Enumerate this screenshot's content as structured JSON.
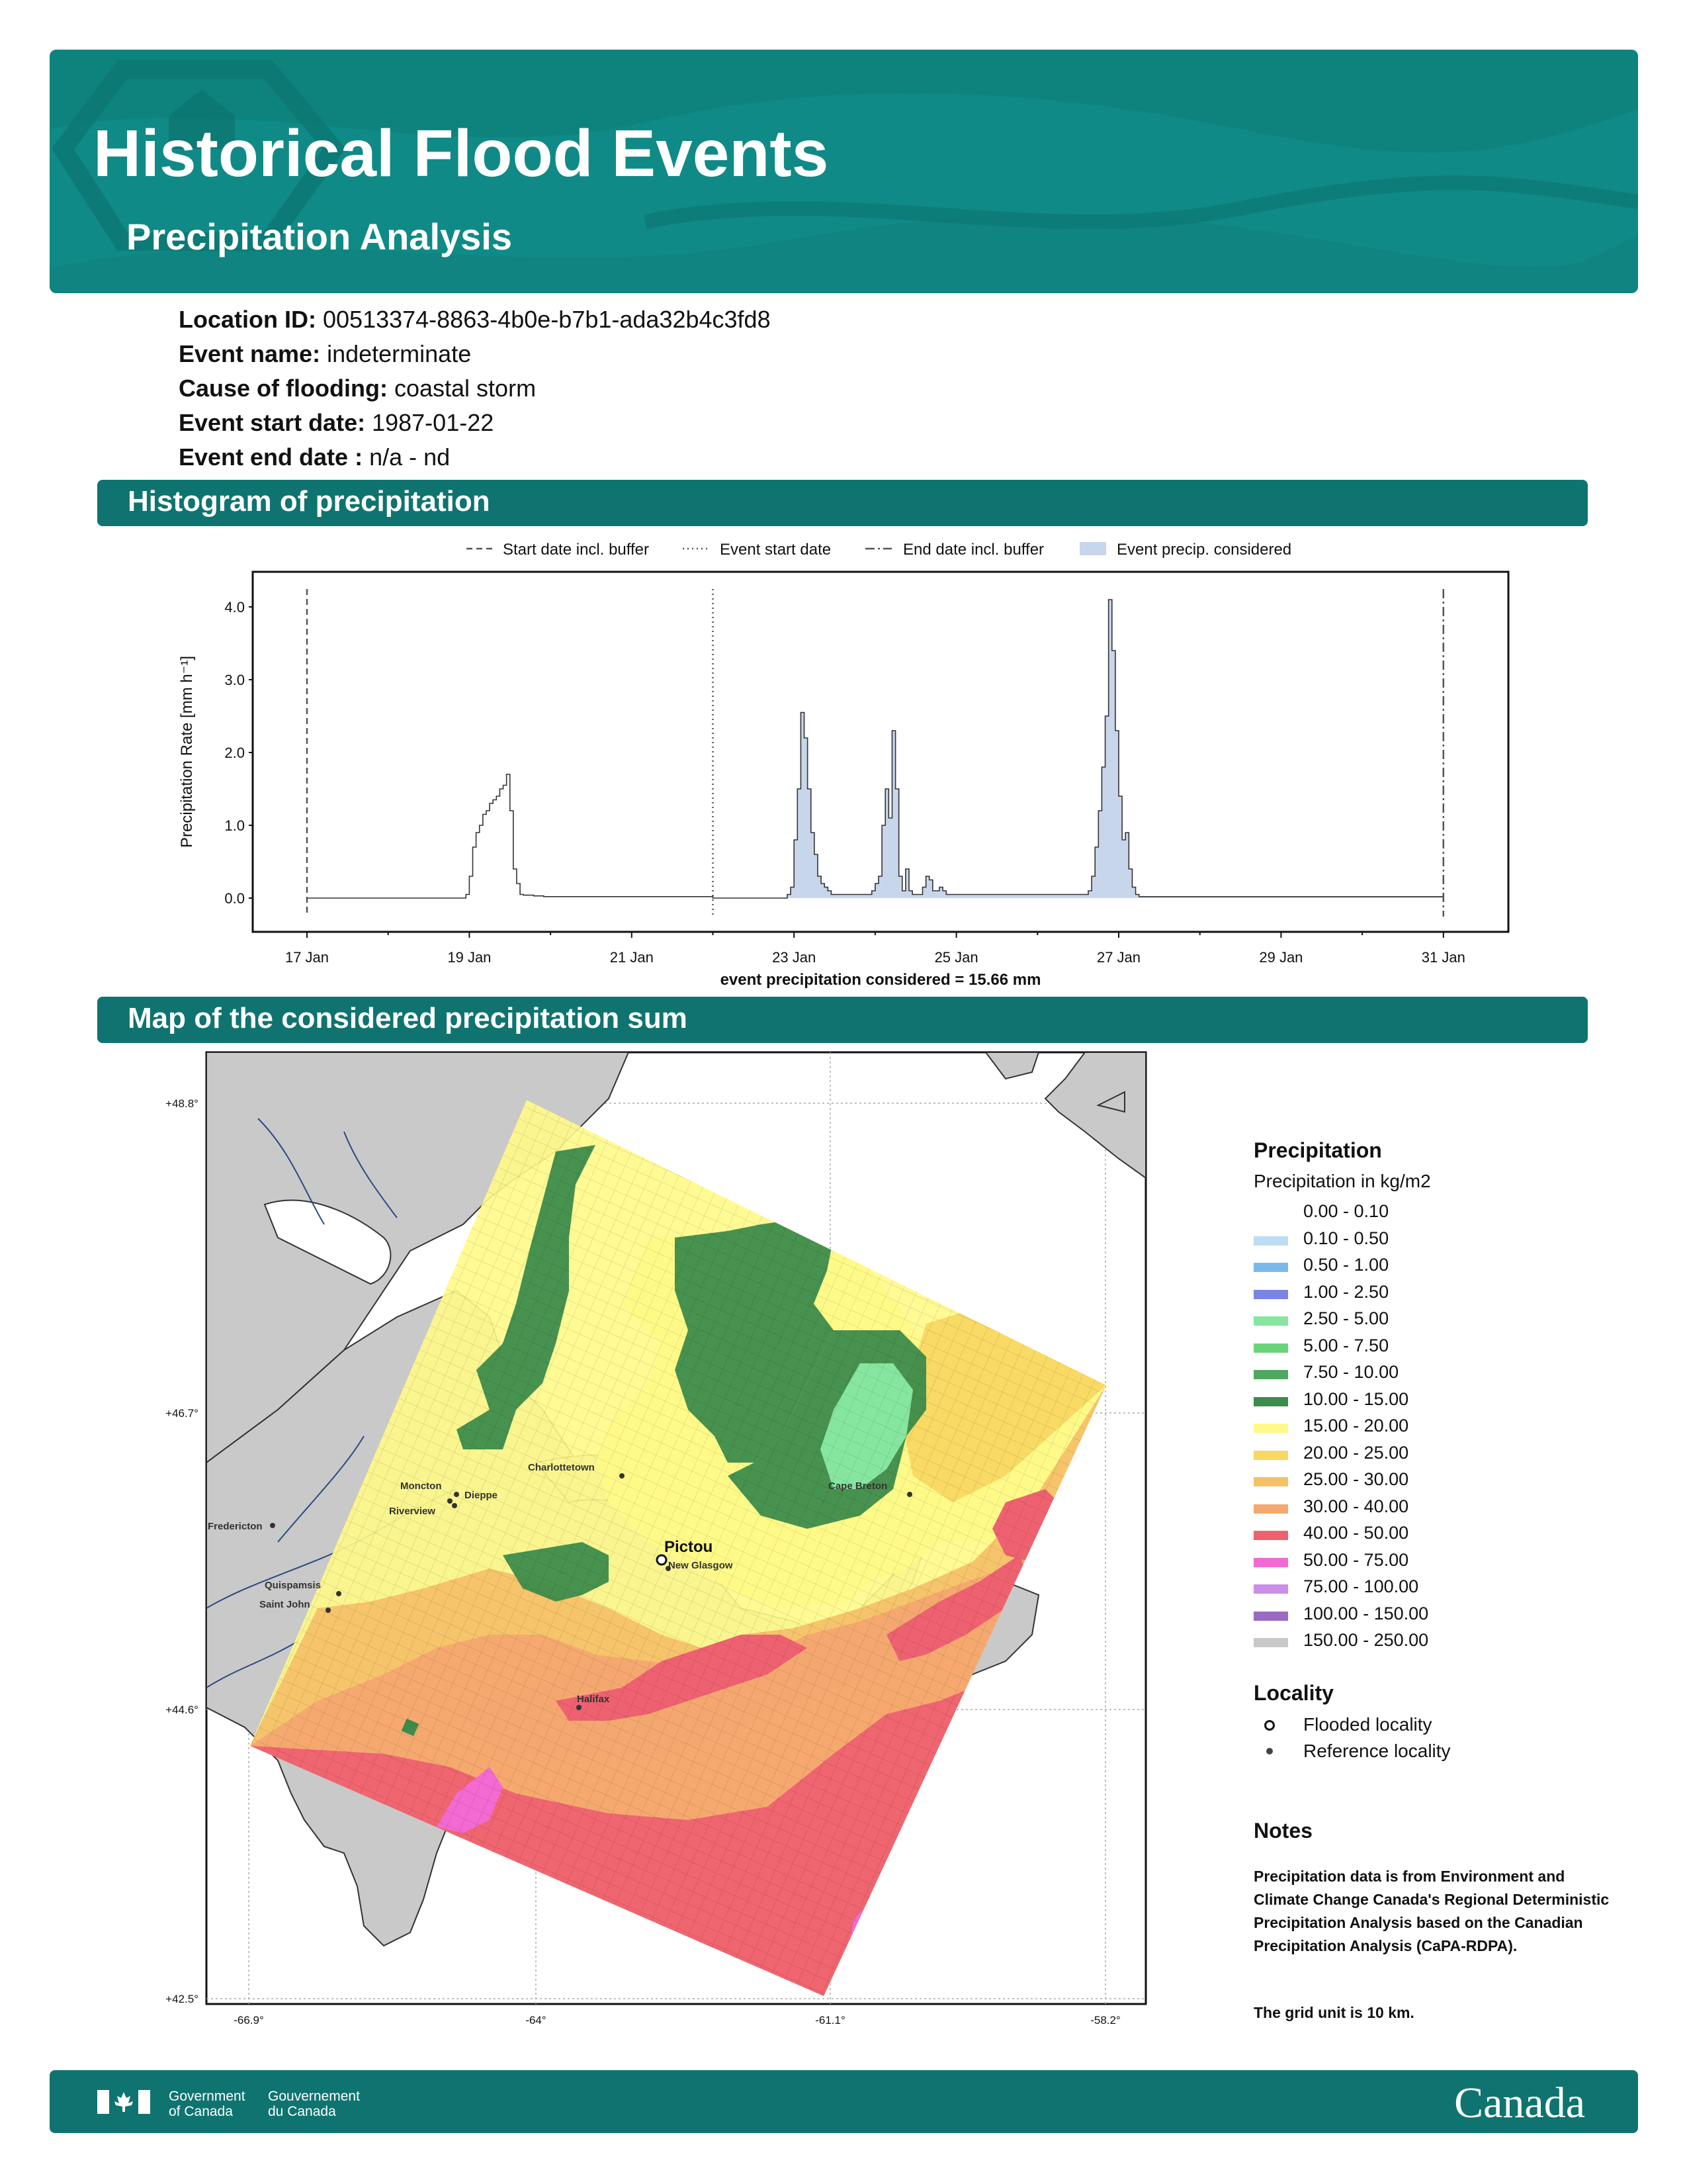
{
  "header": {
    "title": "Historical Flood Events",
    "subtitle": "Precipitation Analysis"
  },
  "event_info": {
    "location_id_label": "Location ID:",
    "location_id": "00513374-8863-4b0e-b7b1-ada32b4c3fd8",
    "event_name_label": "Event name:",
    "event_name": "indeterminate",
    "cause_label": "Cause of flooding:",
    "cause": "coastal storm",
    "start_label": "Event start date:",
    "start": "1987-01-22",
    "end_label": "Event end date :",
    "end": "n/a - nd"
  },
  "sections": {
    "histogram": "Histogram of precipitation",
    "map": "Map of the considered precipitation sum"
  },
  "chart_data": {
    "type": "area",
    "ylabel": "Precipitation Rate [mm h⁻¹]",
    "ylim": [
      0,
      4.4
    ],
    "x_unit": "hours",
    "yticks": [
      "0.0",
      "1.0",
      "2.0",
      "3.0",
      "4.0"
    ],
    "xticks": [
      "17 Jan",
      "19 Jan",
      "21 Jan",
      "23 Jan",
      "25 Jan",
      "27 Jan",
      "29 Jan",
      "31 Jan"
    ],
    "xlabel": "event precipitation considered = 15.66 mm",
    "legend": [
      "Start date incl. buffer",
      "Event start date",
      "End date incl. buffer",
      "Event precip. considered"
    ],
    "vlines": {
      "start_buffer": "1987-01-17",
      "event_start": "1987-01-22",
      "end_buffer": "1987-01-31"
    },
    "fill_range": [
      "1987-01-22",
      "1987-01-31"
    ],
    "series": [
      {
        "x_start": "1987-01-17 00:00",
        "values": [
          0,
          0,
          0,
          0,
          0,
          0,
          0,
          0,
          0,
          0,
          0,
          0,
          0,
          0,
          0,
          0,
          0,
          0,
          0,
          0,
          0,
          0,
          0,
          0,
          0,
          0,
          0,
          0,
          0,
          0,
          0,
          0,
          0,
          0,
          0,
          0,
          0,
          0,
          0,
          0,
          0,
          0,
          0,
          0,
          0,
          0,
          0,
          0.05,
          0.3,
          0.7,
          0.9,
          1.0,
          1.15,
          1.2,
          1.3,
          1.35,
          1.4,
          1.5,
          1.55,
          1.7,
          1.2,
          0.4,
          0.2,
          0.05,
          0.04,
          0.04,
          0.04,
          0.03,
          0.03,
          0.03,
          0.02,
          0.02,
          0.02,
          0.02,
          0.02,
          0.02,
          0.02,
          0.02,
          0.02,
          0.02,
          0.02,
          0.02,
          0.02,
          0.02,
          0.02,
          0.02,
          0.02,
          0.02,
          0.02,
          0.02,
          0.02,
          0.02,
          0.02,
          0.02,
          0.02,
          0.02,
          0.02,
          0.02,
          0.02,
          0.02,
          0.02,
          0.02,
          0.02,
          0.02,
          0.02,
          0.02,
          0.02,
          0.02,
          0.02,
          0.02,
          0.02,
          0.02,
          0.02,
          0.02,
          0.02,
          0.02,
          0.02,
          0.02,
          0.02,
          0.02,
          0,
          0,
          0,
          0,
          0,
          0,
          0,
          0,
          0,
          0,
          0,
          0,
          0,
          0,
          0,
          0,
          0,
          0,
          0,
          0,
          0,
          0,
          0.05,
          0.15,
          0.8,
          1.5,
          2.55,
          2.2,
          1.5,
          0.9,
          0.6,
          0.3,
          0.2,
          0.15,
          0.1,
          0.05,
          0.05,
          0.05,
          0.05,
          0.05,
          0.05,
          0.05,
          0.05,
          0.05,
          0.05,
          0.05,
          0.05,
          0.1,
          0.2,
          0.3,
          1.0,
          1.5,
          1.1,
          2.3,
          1.5,
          0.3,
          0.1,
          0.4,
          0.1,
          0.05,
          0.05,
          0.05,
          0.15,
          0.3,
          0.25,
          0.1,
          0.1,
          0.15,
          0.1,
          0.05,
          0.05,
          0.05,
          0.05,
          0.05,
          0.05,
          0.05,
          0.05,
          0.05,
          0.05,
          0.05,
          0.05,
          0.05,
          0.05,
          0.05,
          0.05,
          0.05,
          0.05,
          0.05,
          0.05,
          0.05,
          0.05,
          0.05,
          0.05,
          0.05,
          0.05,
          0.05,
          0.05,
          0.05,
          0.05,
          0.05,
          0.05,
          0.05,
          0.05,
          0.05,
          0.05,
          0.05,
          0.05,
          0.05,
          0.05,
          0.05,
          0.05,
          0.1,
          0.3,
          0.7,
          1.2,
          1.8,
          2.5,
          4.1,
          3.4,
          2.3,
          1.4,
          0.8,
          0.9,
          0.4,
          0.15,
          0.05,
          0.02,
          0.02,
          0.02,
          0.02,
          0.02,
          0.02,
          0.02,
          0.02,
          0.02,
          0.02,
          0.02,
          0.02,
          0.02,
          0.02,
          0.02,
          0.02,
          0.02,
          0.02,
          0.02,
          0.02,
          0.02,
          0.02,
          0.02,
          0.02,
          0.02,
          0.02,
          0.02,
          0.02,
          0.02,
          0.02,
          0.02,
          0.02,
          0.02,
          0.02,
          0.02,
          0.02,
          0.02,
          0.02,
          0.02,
          0.02,
          0.02,
          0.02,
          0.02,
          0.02,
          0.02,
          0.02,
          0.02,
          0.02,
          0.02,
          0.02,
          0.02,
          0.02,
          0.02,
          0.02,
          0.02,
          0.02,
          0.02,
          0.02,
          0.02,
          0.02,
          0.02,
          0.02,
          0.02,
          0.02,
          0.02,
          0.02,
          0.02,
          0.02,
          0.02,
          0.02,
          0.02,
          0.02,
          0.02,
          0.02,
          0.02,
          0.02,
          0.02,
          0.02,
          0.02,
          0.02,
          0.02,
          0.02,
          0.02,
          0.02,
          0.02,
          0.02,
          0.02,
          0.02,
          0.02,
          0.02
        ]
      }
    ]
  },
  "map": {
    "lat_ticks": [
      "+48.8°",
      "+46.7°",
      "+44.6°",
      "+42.5°"
    ],
    "lon_ticks": [
      "-66.9°",
      "-64°",
      "-61.1°",
      "-58.2°"
    ],
    "places": [
      {
        "name": "Moncton",
        "type": "reference"
      },
      {
        "name": "Dieppe",
        "type": "reference"
      },
      {
        "name": "Riverview",
        "type": "reference"
      },
      {
        "name": "Charlottetown",
        "type": "reference"
      },
      {
        "name": "Cape Breton",
        "type": "reference"
      },
      {
        "name": "Fredericton",
        "type": "reference"
      },
      {
        "name": "Quispamsis",
        "type": "reference"
      },
      {
        "name": "Saint John",
        "type": "reference"
      },
      {
        "name": "Pictou",
        "type": "flooded"
      },
      {
        "name": "New Glasgow",
        "type": "reference"
      },
      {
        "name": "Halifax",
        "type": "reference"
      }
    ]
  },
  "legend": {
    "title": "Precipitation",
    "subtitle": "Precipitation in kg/m2",
    "classes": [
      {
        "label": "0.00 - 0.10",
        "color": "#ffffff"
      },
      {
        "label": "0.10 - 0.50",
        "color": "#bcdcf2"
      },
      {
        "label": "0.50 - 1.00",
        "color": "#7ab8ec"
      },
      {
        "label": "1.00 - 2.50",
        "color": "#7a84e2"
      },
      {
        "label": "2.50 - 5.00",
        "color": "#86e6a0"
      },
      {
        "label": "5.00 - 7.50",
        "color": "#6cd27a"
      },
      {
        "label": "7.50 - 10.00",
        "color": "#4ea860"
      },
      {
        "label": "10.00 - 15.00",
        "color": "#3d8c4b"
      },
      {
        "label": "15.00 - 20.00",
        "color": "#fffa88"
      },
      {
        "label": "20.00 - 25.00",
        "color": "#f8d862"
      },
      {
        "label": "25.00 - 30.00",
        "color": "#f5c168"
      },
      {
        "label": "30.00 - 40.00",
        "color": "#f4a870"
      },
      {
        "label": "40.00 - 50.00",
        "color": "#ee6170"
      },
      {
        "label": "50.00 - 75.00",
        "color": "#f26ad2"
      },
      {
        "label": "75.00 - 100.00",
        "color": "#cb8ee8"
      },
      {
        "label": "100.00 - 150.00",
        "color": "#9a6bc2"
      },
      {
        "label": "150.00 - 250.00",
        "color": "#c8c8c8"
      }
    ]
  },
  "locality": {
    "title": "Locality",
    "flooded": "Flooded locality",
    "reference": "Reference locality"
  },
  "notes": {
    "title": "Notes",
    "text": "Precipitation data is from Environment and Climate Change Canada's Regional Deterministic Precipitation Analysis based on the Canadian Precipitation Analysis (CaPA-RDPA).",
    "grid": "The grid unit is 10 km."
  },
  "footer": {
    "gov_en_1": "Government",
    "gov_en_2": "of Canada",
    "gov_fr_1": "Gouvernement",
    "gov_fr_2": "du Canada",
    "wordmark": "Canada"
  }
}
